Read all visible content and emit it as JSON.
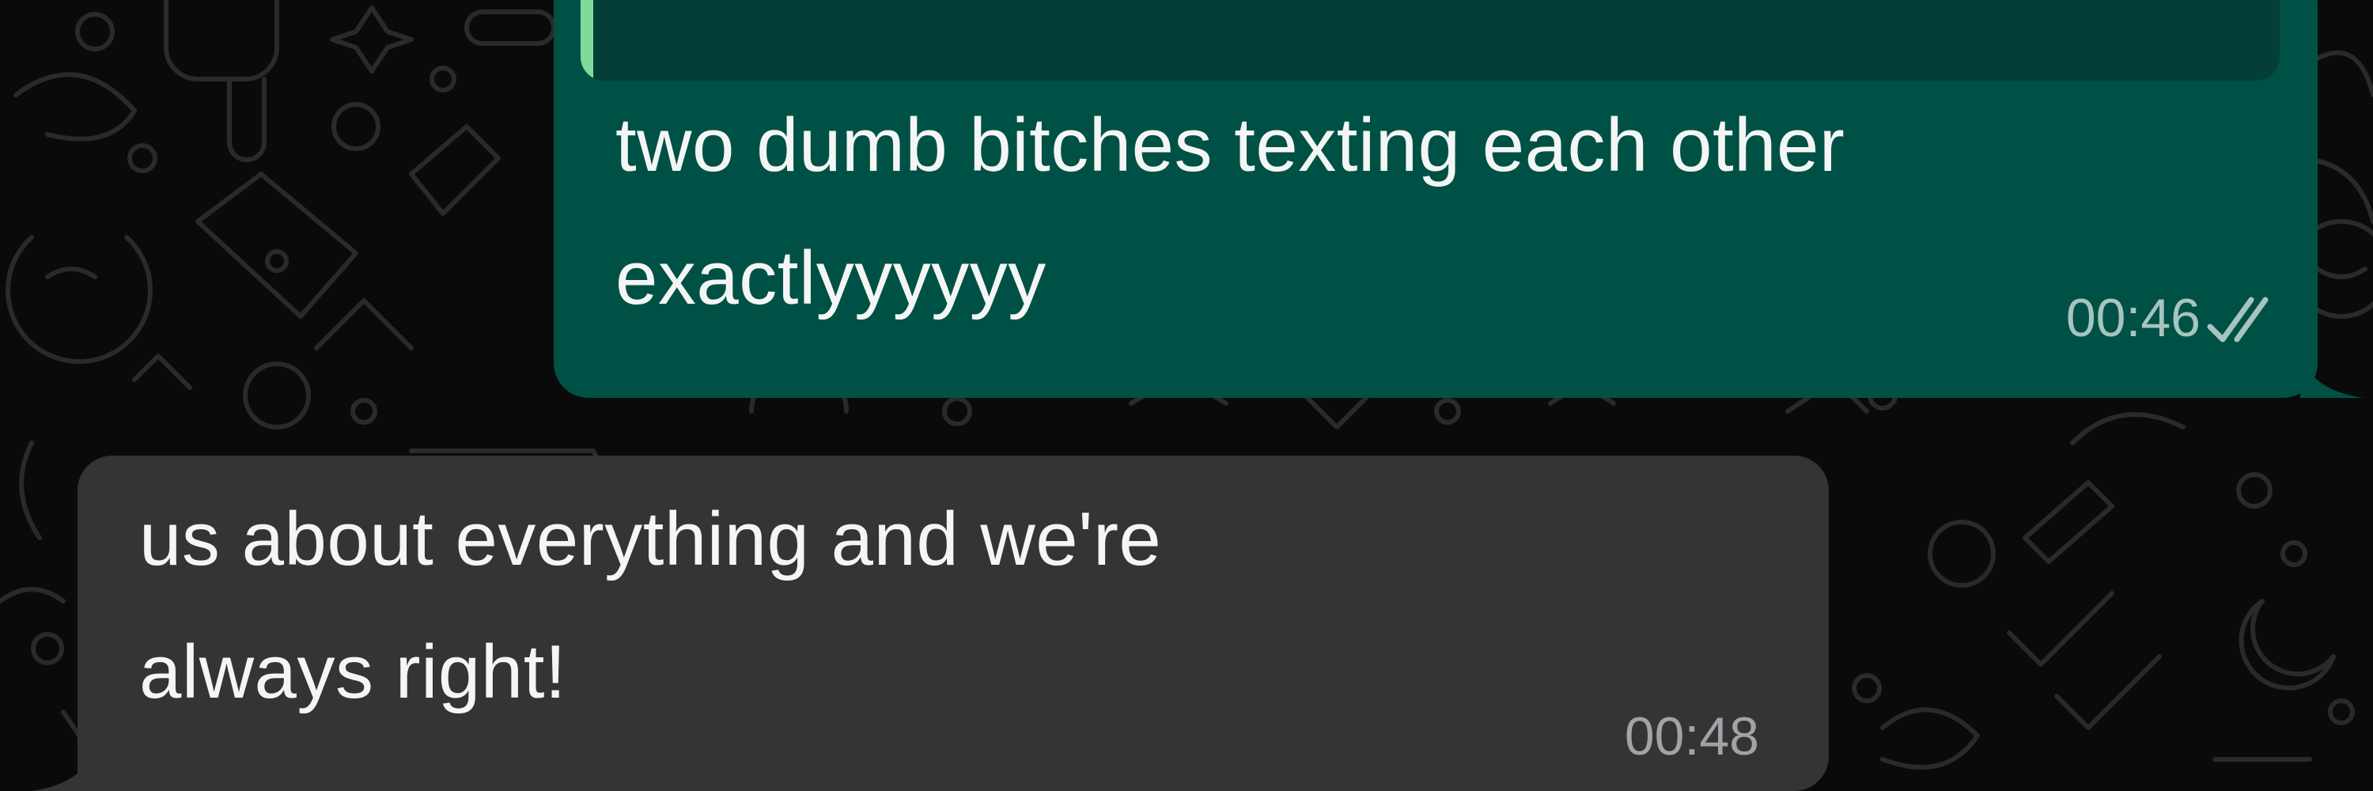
{
  "outgoing": {
    "lines": [
      "two dumb bitches texting each other",
      "exactlyyyyyy"
    ],
    "time": "00:46",
    "status_icon": "double-check-icon",
    "bubble_color": "#005145",
    "quote_bar_color": "#7ddc9a"
  },
  "incoming": {
    "lines": [
      "us about everything and we're",
      "always right!"
    ],
    "time": "00:48",
    "bubble_color": "#343436"
  },
  "background": {
    "color": "#0a0a0a",
    "pattern": "doodle-wallpaper"
  }
}
